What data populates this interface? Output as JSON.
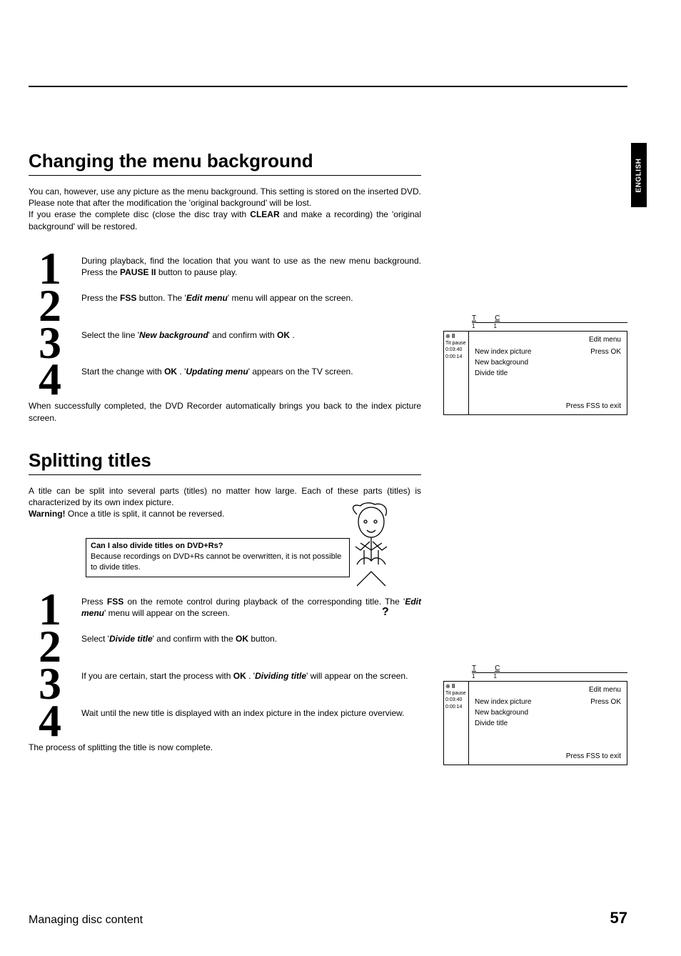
{
  "language": "ENGLISH",
  "section1": {
    "title": "Changing the menu background",
    "intro_1": "You can, however, use any picture as the menu background. This setting is stored on the inserted DVD. Please note that after the modification the 'original background' will be lost.",
    "intro_2a": "If you erase the complete disc (close the disc tray with ",
    "intro_2b": "CLEAR",
    "intro_2c": " and make a recording) the 'original background' will be restored.",
    "step1a": "During playback, find the location that you want to use as the new menu background. Press the ",
    "step1b": "PAUSE II",
    "step1c": " button to pause play.",
    "step2a": "Press the ",
    "step2b": "FSS",
    "step2c": " button. The '",
    "step2d": "Edit menu",
    "step2e": "' menu will appear on the screen.",
    "step3a": "Select the line '",
    "step3b": "New background",
    "step3c": "' and confirm with ",
    "step3d": "OK",
    "step3e": " .",
    "step4a": "Start the change with ",
    "step4b": "OK",
    "step4c": " . '",
    "step4d": "Updating menu",
    "step4e": "' appears on the TV screen.",
    "outro": "When successfully completed, the DVD Recorder automatically brings you back to the index picture screen."
  },
  "section2": {
    "title": "Splitting titles",
    "intro_1": "A title can be split into several parts (titles) no matter how large. Each of these parts (titles) is characterized by its own index picture.",
    "intro_2a": "Warning!",
    "intro_2b": " Once a title is split, it cannot be reversed.",
    "faq_title": "Can I also divide titles on DVD+Rs?",
    "faq_body": "Because recordings on DVD+Rs cannot be overwritten, it is not possible to divide titles.",
    "q": "?",
    "step1a": "Press ",
    "step1b": "FSS",
    "step1c": " on the remote control during playback of the corresponding title. The '",
    "step1d": "Edit menu",
    "step1e": "' menu will appear on the screen.",
    "step2a": "Select '",
    "step2b": "Divide title",
    "step2c": "' and confirm with the ",
    "step2d": "OK",
    "step2e": " button.",
    "step3a": "If you are certain, start the process with ",
    "step3b": "OK",
    "step3c": " . '",
    "step3d": "Dividing title",
    "step3e": "' will appear on the screen.",
    "step4": "Wait until the new title is displayed with an index picture in the index picture overview.",
    "outro": "The process of splitting the title is now complete."
  },
  "panel1": {
    "T": "T",
    "C": "C",
    "one1": "1",
    "one2": "1",
    "pause": "Tit pause",
    "t1": "0:03:40",
    "t2": "0:00:14",
    "header": "Edit menu",
    "m1": "New index picture",
    "m1r": "Press OK",
    "m2": "New background",
    "m3": "Divide title",
    "footer": "Press FSS to exit"
  },
  "panel2": {
    "T": "T",
    "C": "C",
    "one1": "1",
    "one2": "1",
    "pause": "Tit pause",
    "t1": "0:03:40",
    "t2": "0:00:14",
    "header": "Edit menu",
    "m1": "New index picture",
    "m1r": "Press OK",
    "m2": "New background",
    "m3": "Divide title",
    "footer": "Press FSS to exit"
  },
  "footer": {
    "left": "Managing disc content",
    "right": "57"
  }
}
